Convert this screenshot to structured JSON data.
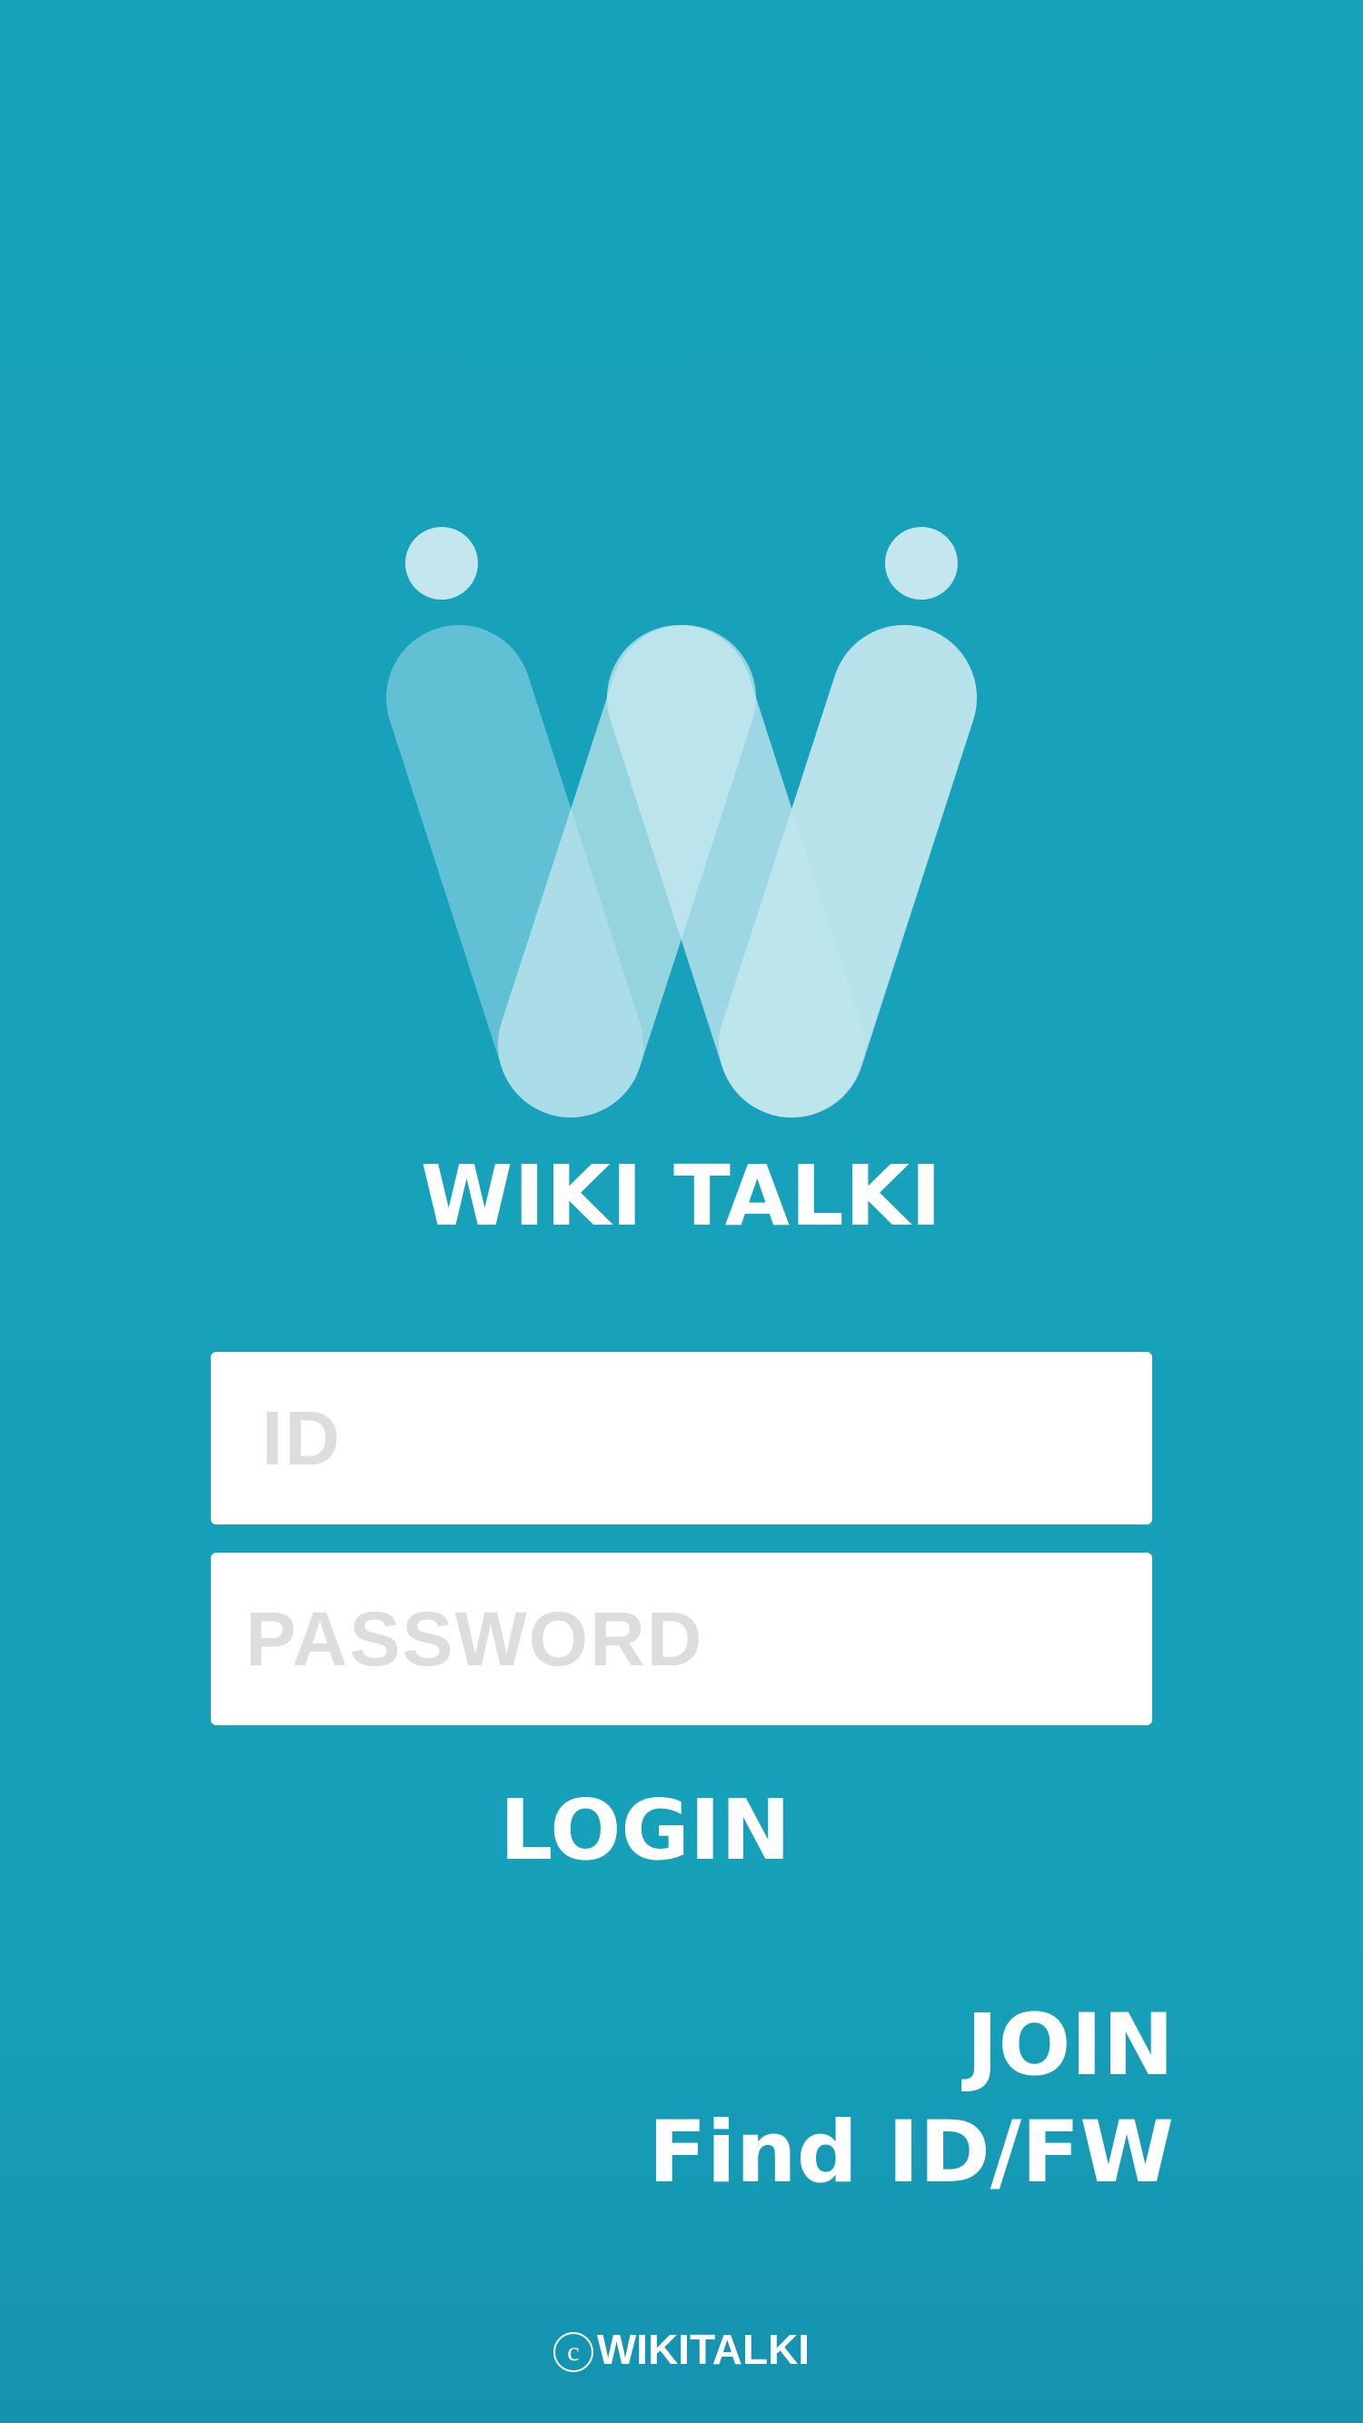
{
  "app": {
    "title": "WIKI TALKI",
    "logo_icon": "wiki-talki-w-logo"
  },
  "login_form": {
    "id_placeholder": "ID",
    "id_value": "",
    "password_placeholder": "PASSWORD",
    "password_value": "",
    "login_label": "LOGIN"
  },
  "links": {
    "join_label": "JOIN",
    "find_label": "Find ID/FW"
  },
  "footer": {
    "copyright_symbol": "c",
    "copyright_text": "WIKITALKI"
  },
  "colors": {
    "background": "#17a2bb",
    "logo_light": "#c9e9f0",
    "logo_mid": "#a3d9e4",
    "logo_dark": "#6fc5d8",
    "input_background": "#ffffff",
    "placeholder_text": "#dddddd",
    "text": "#ffffff"
  }
}
